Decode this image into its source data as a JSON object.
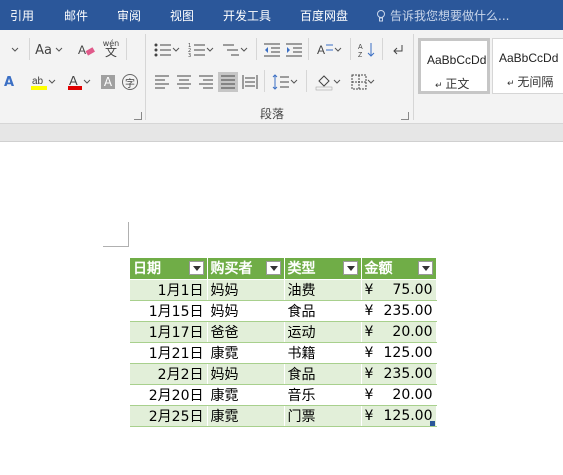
{
  "tabs": [
    "引用",
    "邮件",
    "审阅",
    "视图",
    "开发工具",
    "百度网盘"
  ],
  "tell_me": "告诉我您想要做什么...",
  "ribbon": {
    "font_size_label": "Aa",
    "char_border_label": "A",
    "enclose_char_label": "字",
    "phonetic_label": "wén",
    "phonetic_sub": "文",
    "paragraph_group": "段落",
    "styles": [
      {
        "sample": "AaBbCcDd",
        "name": "正文"
      },
      {
        "sample": "AaBbCcDd",
        "name": "无间隔"
      }
    ]
  },
  "table": {
    "headers": [
      "日期",
      "购买者",
      "类型",
      "金额"
    ],
    "currency": "¥",
    "rows": [
      {
        "date": "1月1日",
        "buyer": "妈妈",
        "type": "油费",
        "amount": "75.00"
      },
      {
        "date": "1月15日",
        "buyer": "妈妈",
        "type": "食品",
        "amount": "235.00"
      },
      {
        "date": "1月17日",
        "buyer": "爸爸",
        "type": "运动",
        "amount": "20.00"
      },
      {
        "date": "1月21日",
        "buyer": "康霓",
        "type": "书籍",
        "amount": "125.00"
      },
      {
        "date": "2月2日",
        "buyer": "妈妈",
        "type": "食品",
        "amount": "235.00"
      },
      {
        "date": "2月20日",
        "buyer": "康霓",
        "type": "音乐",
        "amount": "20.00"
      },
      {
        "date": "2月25日",
        "buyer": "康霓",
        "type": "门票",
        "amount": "125.00"
      }
    ]
  },
  "colors": {
    "tab_bar": "#2b579a",
    "table_header": "#70ad47",
    "table_band": "#e2efd9"
  }
}
